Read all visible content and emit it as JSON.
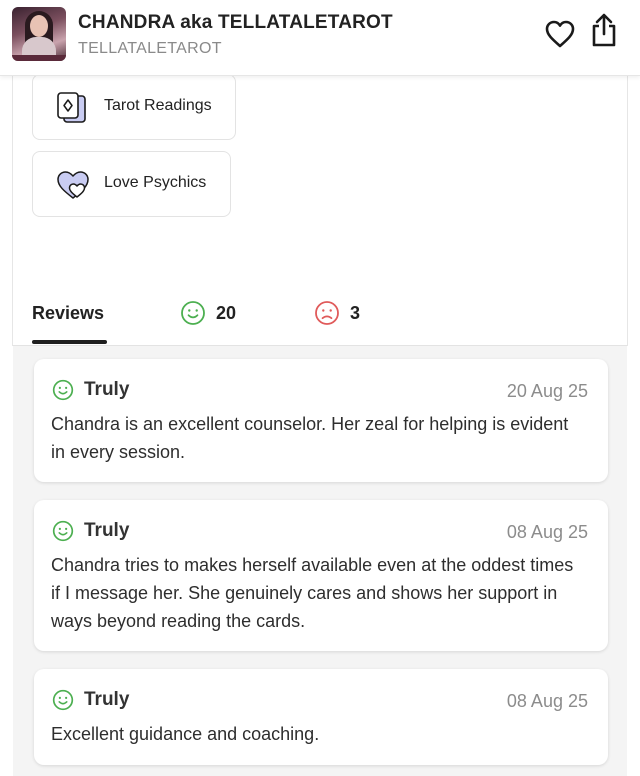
{
  "header": {
    "title": "CHANDRA aka TELLATALETAROT",
    "subtitle": "TELLATALETAROT",
    "favorite_icon": "heart-outline-icon",
    "share_icon": "share-icon"
  },
  "categories": [
    {
      "label": "Tarot Readings",
      "icon": "tarot-cards-icon"
    },
    {
      "label": "Love Psychics",
      "icon": "hearts-icon"
    }
  ],
  "tabs": {
    "reviews_label": "Reviews",
    "positive_count": "20",
    "negative_count": "3"
  },
  "reviews": [
    {
      "author": "Truly",
      "date": "20 Aug 25",
      "text": "Chandra is an excellent counselor. Her zeal for helping is evident in every session."
    },
    {
      "author": "Truly",
      "date": "08 Aug 25",
      "text": "Chandra tries to makes herself available even at the oddest times if I message her. She genuinely cares and shows her support in ways beyond reading the cards."
    },
    {
      "author": "Truly",
      "date": "08 Aug 25",
      "text": "Excellent guidance and coaching."
    }
  ],
  "colors": {
    "positive": "#4caf50",
    "negative": "#e05a5a",
    "accent_icon": "#c9ccf2"
  }
}
